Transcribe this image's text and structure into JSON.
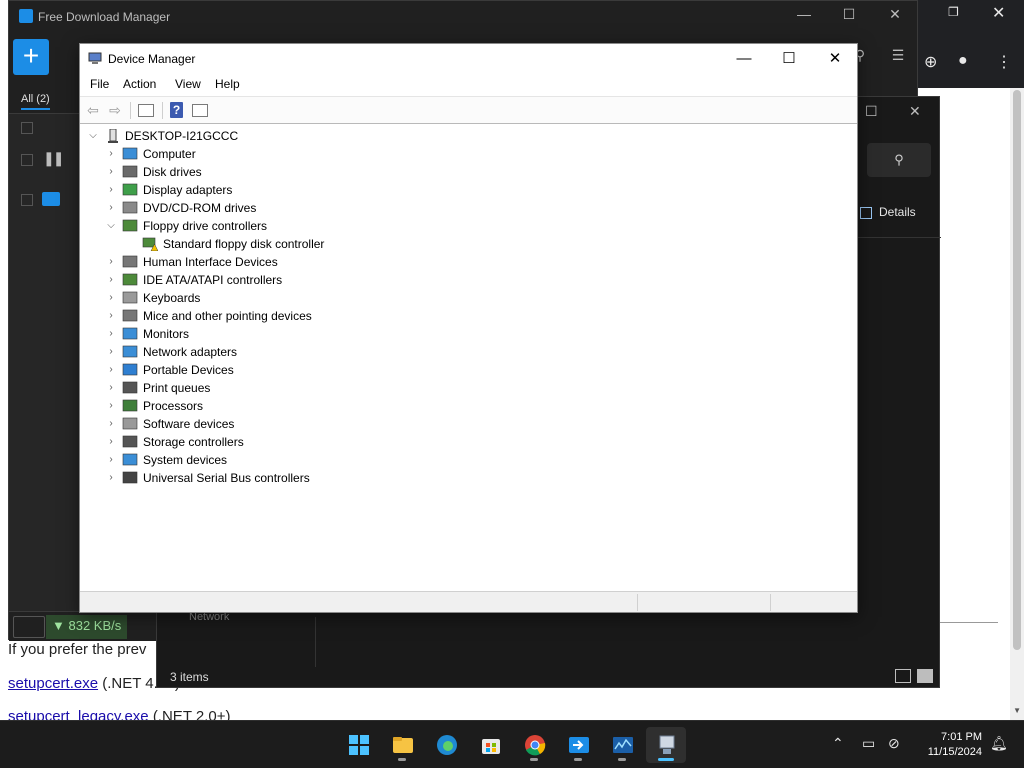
{
  "web_page": {
    "line1": "If you prefer the prev",
    "link1": "setupcert.exe",
    "link1_suffix": "(.NET 4.0+)",
    "link2": "setupcert_legacy.exe",
    "link2_suffix": "(.NET 2.0+)"
  },
  "fdm": {
    "title": "Free Download Manager",
    "add_label": "+",
    "tab_all": "All (2)",
    "speed": "832 KB/s"
  },
  "explorer": {
    "details_label": "Details",
    "nav_network": "Network",
    "status": "3 items"
  },
  "device_manager": {
    "title": "Device Manager",
    "menu": [
      "File",
      "Action",
      "View",
      "Help"
    ],
    "root": "DESKTOP-I21GCCC",
    "nodes": [
      {
        "label": "Computer",
        "icon": "computer-icon",
        "expanded": false
      },
      {
        "label": "Disk drives",
        "icon": "disk-drive-icon",
        "expanded": false
      },
      {
        "label": "Display adapters",
        "icon": "display-adapter-icon",
        "expanded": false
      },
      {
        "label": "DVD/CD-ROM drives",
        "icon": "dvd-drive-icon",
        "expanded": false
      },
      {
        "label": "Floppy drive controllers",
        "icon": "floppy-controller-icon",
        "expanded": true
      },
      {
        "label": "Human Interface Devices",
        "icon": "hid-icon",
        "expanded": false
      },
      {
        "label": "IDE ATA/ATAPI controllers",
        "icon": "ide-controller-icon",
        "expanded": false
      },
      {
        "label": "Keyboards",
        "icon": "keyboard-icon",
        "expanded": false
      },
      {
        "label": "Mice and other pointing devices",
        "icon": "mouse-icon",
        "expanded": false
      },
      {
        "label": "Monitors",
        "icon": "monitor-icon",
        "expanded": false
      },
      {
        "label": "Network adapters",
        "icon": "network-adapter-icon",
        "expanded": false
      },
      {
        "label": "Portable Devices",
        "icon": "portable-device-icon",
        "expanded": false
      },
      {
        "label": "Print queues",
        "icon": "printer-icon",
        "expanded": false
      },
      {
        "label": "Processors",
        "icon": "processor-icon",
        "expanded": false
      },
      {
        "label": "Software devices",
        "icon": "software-device-icon",
        "expanded": false
      },
      {
        "label": "Storage controllers",
        "icon": "storage-controller-icon",
        "expanded": false
      },
      {
        "label": "System devices",
        "icon": "system-device-icon",
        "expanded": false
      },
      {
        "label": "Universal Serial Bus controllers",
        "icon": "usb-icon",
        "expanded": false
      }
    ],
    "floppy_child": {
      "label": "Standard floppy disk controller",
      "icon": "warning-device-icon"
    }
  },
  "taskbar": {
    "apps": [
      "start",
      "file-explorer",
      "edge",
      "store",
      "chrome",
      "free-download-manager",
      "resource-monitor",
      "device-manager"
    ],
    "time": "7:01 PM",
    "date": "11/15/2024"
  },
  "colors": {
    "accent": "#1c8de6",
    "taskbar_active": "#4cc2ff",
    "link": "#1a0dab"
  }
}
